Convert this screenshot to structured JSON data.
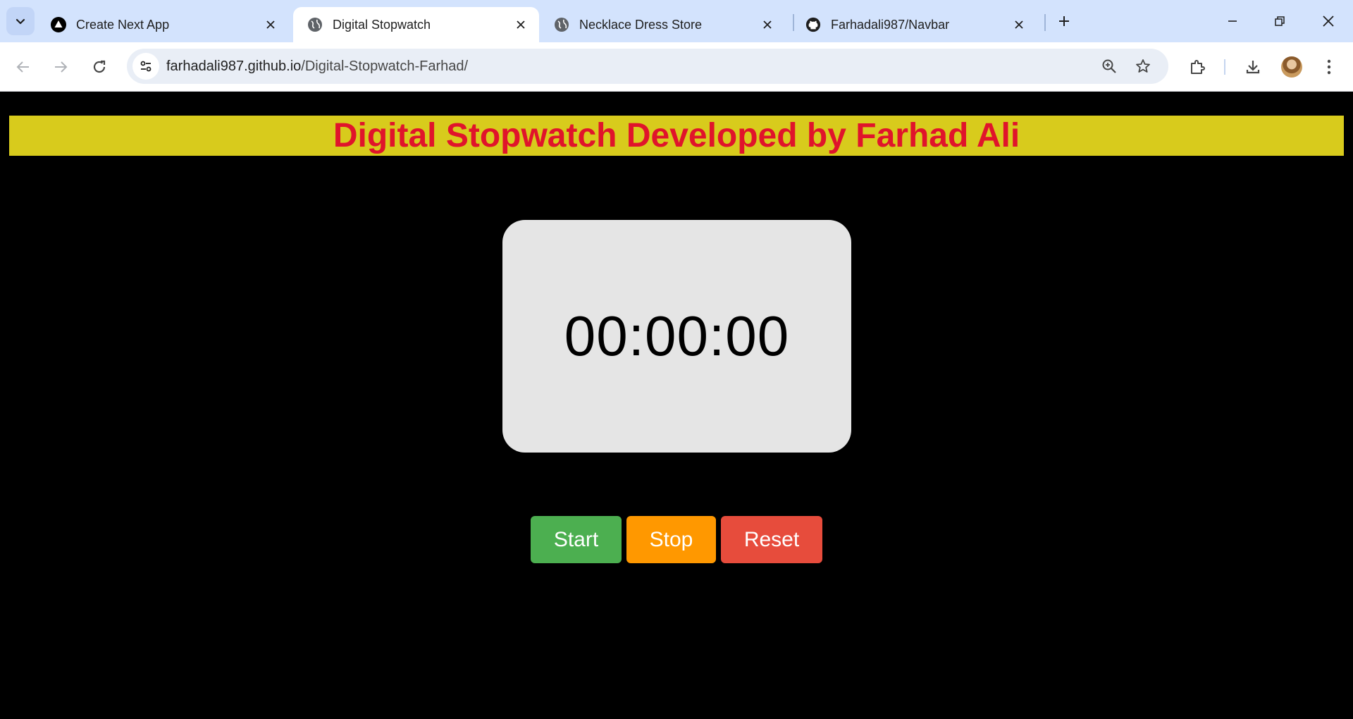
{
  "browser": {
    "tabs": [
      {
        "title": "Create Next App",
        "icon": "triangle-logo-icon",
        "active": false
      },
      {
        "title": "Digital Stopwatch",
        "icon": "globe-icon",
        "active": true
      },
      {
        "title": "Necklace Dress Store",
        "icon": "globe-icon",
        "active": false
      },
      {
        "title": "Farhadali987/Navbar",
        "icon": "github-icon",
        "active": false
      }
    ],
    "url": {
      "host": "farhadali987.github.io",
      "path": "/Digital-Stopwatch-Farhad/"
    },
    "colors": {
      "tabstrip": "#d3e3fd",
      "omnibox": "#e9eef6"
    }
  },
  "page": {
    "title": "Digital Stopwatch Developed by Farhad Ali",
    "time": "00:00:00",
    "buttons": {
      "start": "Start",
      "stop": "Stop",
      "reset": "Reset"
    },
    "colors": {
      "background": "#000000",
      "banner": "#d8cb1c",
      "title_text": "#e0142b",
      "display_card": "#e5e5e5",
      "start": "#4caf50",
      "stop": "#ff9800",
      "reset": "#e74c3c"
    }
  }
}
